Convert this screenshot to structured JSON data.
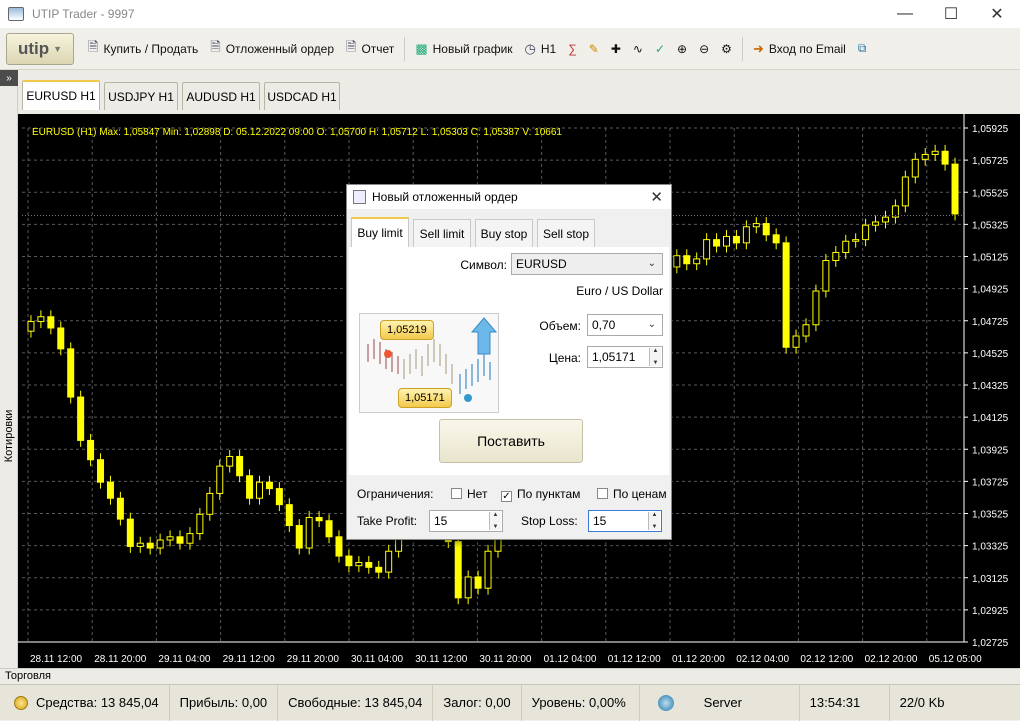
{
  "window": {
    "title": "UTIP Trader - 9997"
  },
  "toolbar": {
    "logo": "utip",
    "buy_sell": "Купить / Продать",
    "pending": "Отложенный ордер",
    "report": "Отчет",
    "new_chart": "Новый график",
    "timeframe": "H1",
    "login_email": "Вход по Email"
  },
  "left_panel": {
    "label": "Котировки"
  },
  "chart_tabs": [
    {
      "label": "EURUSD  H1"
    },
    {
      "label": "USDJPY  H1"
    },
    {
      "label": "AUDUSD  H1"
    },
    {
      "label": "USDCAD  H1"
    }
  ],
  "chart_data": {
    "type": "candlestick",
    "symbol": "EURUSD",
    "timeframe": "H1",
    "header": "EURUSD (H1)  Max: 1,05847  Min: 1,02898  D: 05.12.2022 09:00  O: 1,05700  H: 1,05712  L: 1,05303  C: 1,05387  V: 10661",
    "ylim": [
      1.02725,
      1.05925
    ],
    "y_ticks": [
      "1,05925",
      "1,05725",
      "1,05525",
      "1,05325",
      "1,05125",
      "1,04925",
      "1,04725",
      "1,04525",
      "1,04325",
      "1,04125",
      "1,03925",
      "1,03725",
      "1,03525",
      "1,03325",
      "1,03125",
      "1,02925",
      "1,02725"
    ],
    "x_ticks": [
      "28.11 12:00",
      "28.11 20:00",
      "29.11 04:00",
      "29.11 12:00",
      "29.11 20:00",
      "30.11 04:00",
      "30.11 12:00",
      "30.11 20:00",
      "01.12 04:00",
      "01.12 12:00",
      "01.12 20:00",
      "02.12 04:00",
      "02.12 12:00",
      "02.12 20:00",
      "05.12 05:00"
    ],
    "grid": true,
    "colors": {
      "background": "#000000",
      "candle": "#ffff00",
      "grid": "#5a5a5a",
      "text": "#ffffff",
      "header": "#ffff00"
    },
    "closes": [
      1.0472,
      1.0475,
      1.0468,
      1.0455,
      1.0425,
      1.0398,
      1.0386,
      1.0372,
      1.0362,
      1.0349,
      1.0332,
      1.0334,
      1.0331,
      1.0336,
      1.0338,
      1.0334,
      1.034,
      1.0352,
      1.0365,
      1.0382,
      1.0388,
      1.0376,
      1.0362,
      1.0372,
      1.0368,
      1.0358,
      1.0345,
      1.0331,
      1.035,
      1.0348,
      1.0338,
      1.0326,
      1.032,
      1.0322,
      1.0319,
      1.0316,
      1.0329,
      1.0348,
      1.036,
      1.0352,
      1.0378,
      1.0352,
      1.0335,
      1.03,
      1.0313,
      1.0306,
      1.0329,
      1.035,
      1.0371,
      1.0392,
      1.0412,
      1.0438,
      1.0452,
      1.047,
      1.0485,
      1.0501,
      1.0497,
      1.0508,
      1.0517,
      1.0522,
      1.0515,
      1.0518,
      1.051,
      1.0501,
      1.0506,
      1.0513,
      1.0508,
      1.0511,
      1.0523,
      1.0519,
      1.0525,
      1.0521,
      1.0531,
      1.0533,
      1.0526,
      1.0521,
      1.0456,
      1.0463,
      1.047,
      1.0491,
      1.051,
      1.0515,
      1.0522,
      1.0523,
      1.0532,
      1.0534,
      1.0537,
      1.0544,
      1.0562,
      1.0573,
      1.0576,
      1.0578,
      1.057,
      1.0539
    ],
    "price_line": 1.0538
  },
  "dialog": {
    "title": "Новый отложенный ордер",
    "tabs": [
      "Buy limit",
      "Sell limit",
      "Buy stop",
      "Sell stop"
    ],
    "active_tab": 0,
    "symbol_label": "Символ:",
    "symbol_value": "EURUSD",
    "symbol_desc": "Euro / US Dollar",
    "volume_label": "Объем:",
    "volume_value": "0,70",
    "price_label": "Цена:",
    "price_value": "1,05171",
    "illus_top_price": "1,05219",
    "illus_bottom_price": "1,05171",
    "submit_label": "Поставить",
    "limits_label": "Ограничения:",
    "opt_none": "Нет",
    "opt_points": "По пунктам",
    "opt_prices": "По ценам",
    "selected_option": "opt_points",
    "tp_label": "Take Profit:",
    "tp_value": "15",
    "sl_label": "Stop Loss:",
    "sl_value": "15"
  },
  "bottom_panel": {
    "label": "Торговля"
  },
  "status": {
    "funds": "Средства: 13 845,04",
    "profit": "Прибыль: 0,00",
    "free": "Свободные: 13 845,04",
    "margin": "Залог: 0,00",
    "level": "Уровень: 0,00%",
    "server": "Server",
    "time": "13:54:31",
    "traffic": "22/0 Kb"
  }
}
